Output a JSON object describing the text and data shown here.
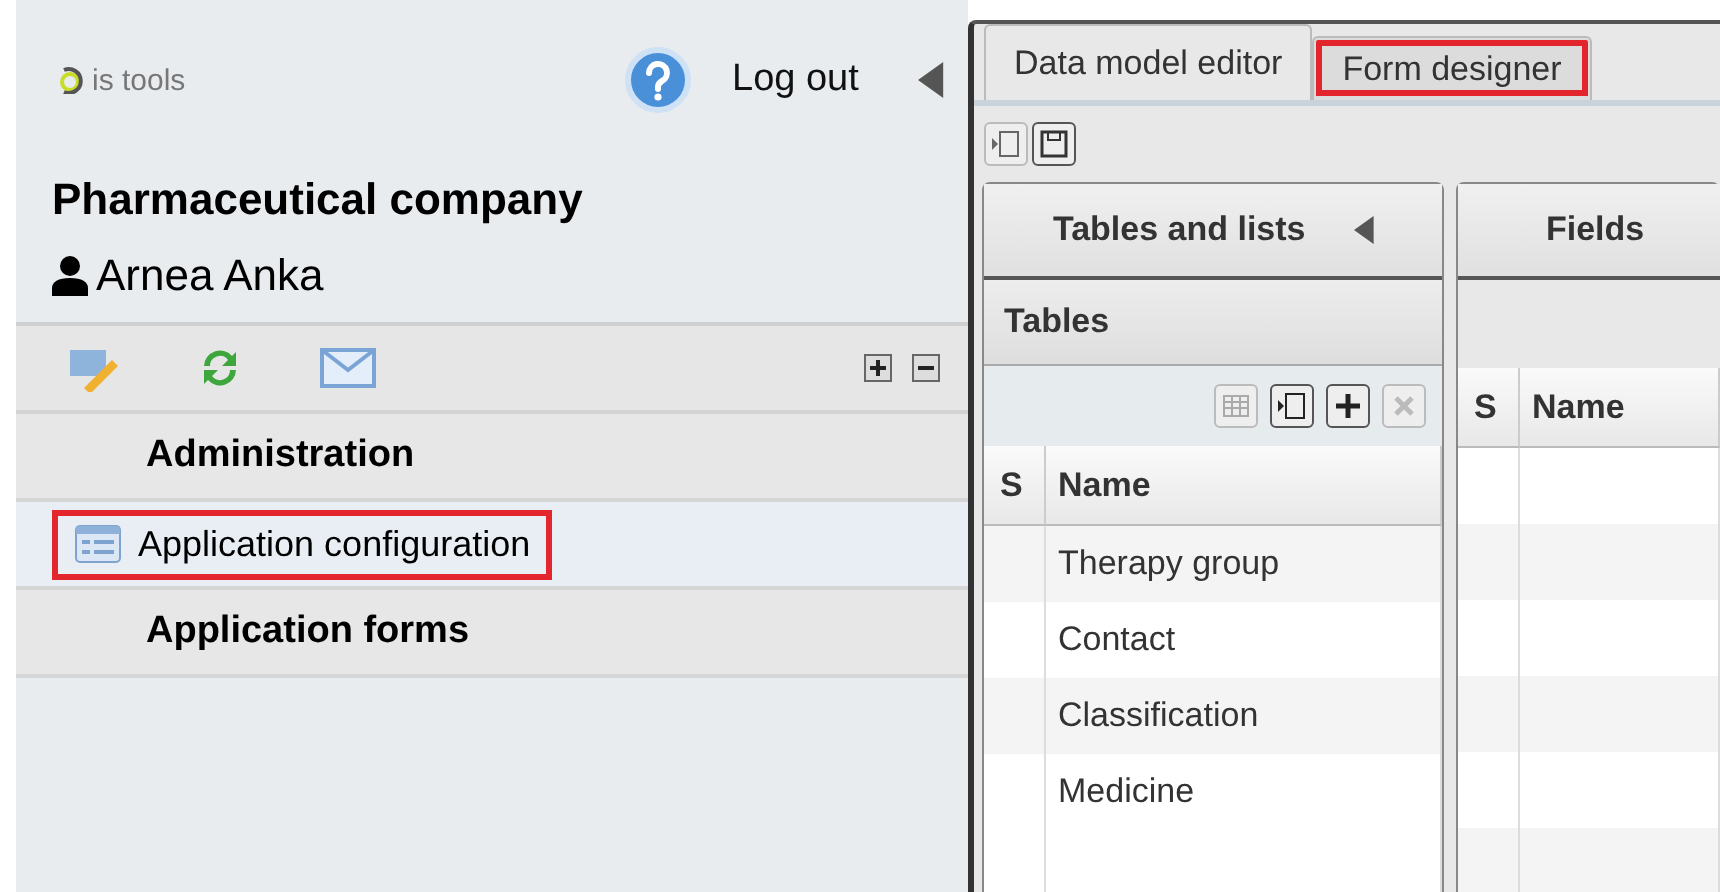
{
  "header": {
    "logo": "is tools",
    "logout": "Log out"
  },
  "company": "Pharmaceutical company",
  "user": "Arnea Anka",
  "nav": [
    {
      "label": "Administration",
      "kind": "group",
      "selected": false,
      "highlighted": false
    },
    {
      "label": "Application configuration",
      "kind": "item",
      "selected": true,
      "highlighted": true
    },
    {
      "label": "Application forms",
      "kind": "group",
      "selected": false,
      "highlighted": false
    }
  ],
  "tabs": [
    {
      "label": "Data model editor",
      "selected": true,
      "highlighted": false
    },
    {
      "label": "Form designer",
      "selected": false,
      "highlighted": true
    }
  ],
  "tables_panel": {
    "title": "Tables and lists",
    "subtitle": "Tables",
    "columns": [
      "S",
      "Name"
    ],
    "rows": [
      "Therapy group",
      "Contact",
      "Classification",
      "Medicine"
    ]
  },
  "fields_panel": {
    "title": "Fields",
    "columns": [
      "S",
      "Name"
    ]
  }
}
